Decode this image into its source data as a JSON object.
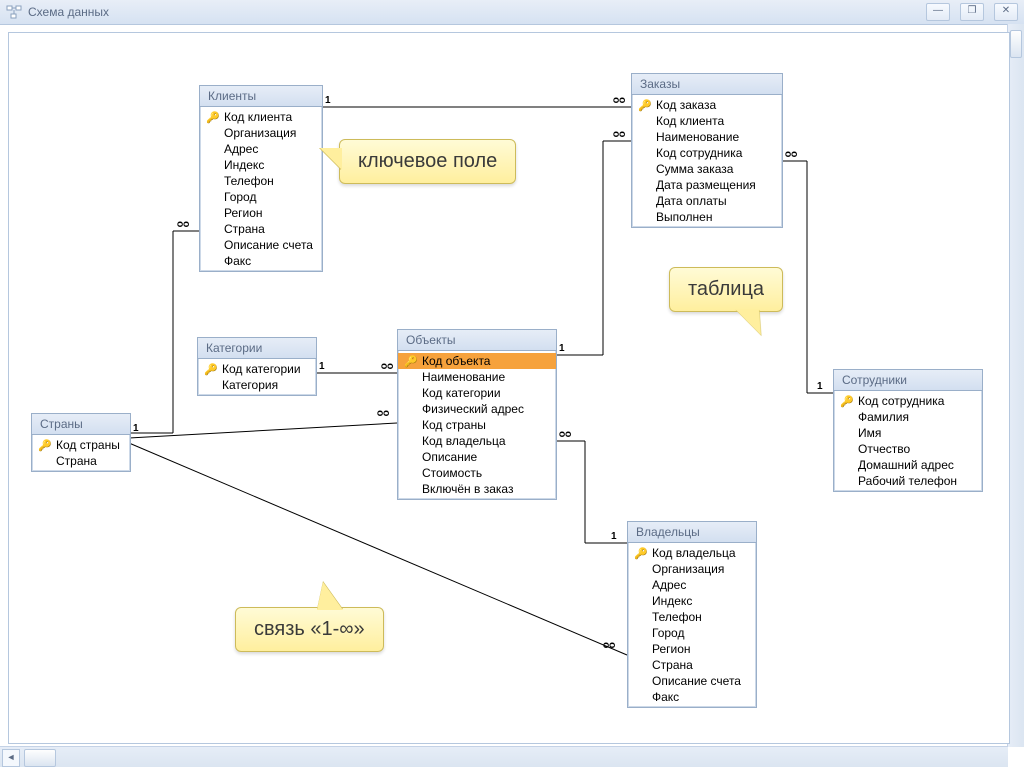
{
  "window": {
    "title": "Схема данных"
  },
  "callouts": {
    "key": "ключевое поле",
    "table": "таблица",
    "rel": "связь «1-∞»"
  },
  "symbols": {
    "one": "1",
    "many": "∞",
    "many_lig": "ᴑᴑ"
  },
  "tables": {
    "clients": {
      "title": "Клиенты",
      "fields": [
        {
          "k": true,
          "n": "Код клиента"
        },
        {
          "k": false,
          "n": "Организация"
        },
        {
          "k": false,
          "n": "Адрес"
        },
        {
          "k": false,
          "n": "Индекс"
        },
        {
          "k": false,
          "n": "Телефон"
        },
        {
          "k": false,
          "n": "Город"
        },
        {
          "k": false,
          "n": "Регион"
        },
        {
          "k": false,
          "n": "Страна"
        },
        {
          "k": false,
          "n": "Описание счета"
        },
        {
          "k": false,
          "n": "Факс"
        }
      ]
    },
    "countries": {
      "title": "Страны",
      "fields": [
        {
          "k": true,
          "n": "Код страны"
        },
        {
          "k": false,
          "n": "Страна"
        }
      ]
    },
    "categories": {
      "title": "Категории",
      "fields": [
        {
          "k": true,
          "n": "Код категории"
        },
        {
          "k": false,
          "n": "Категория"
        }
      ]
    },
    "objects": {
      "title": "Объекты",
      "fields": [
        {
          "k": true,
          "n": "Код объекта",
          "sel": true
        },
        {
          "k": false,
          "n": "Наименование"
        },
        {
          "k": false,
          "n": "Код категории"
        },
        {
          "k": false,
          "n": "Физический адрес"
        },
        {
          "k": false,
          "n": "Код страны"
        },
        {
          "k": false,
          "n": "Код владельца"
        },
        {
          "k": false,
          "n": "Описание"
        },
        {
          "k": false,
          "n": "Стоимость"
        },
        {
          "k": false,
          "n": "Включён в заказ"
        }
      ]
    },
    "orders": {
      "title": "Заказы",
      "fields": [
        {
          "k": true,
          "n": "Код заказа"
        },
        {
          "k": false,
          "n": "Код клиента"
        },
        {
          "k": false,
          "n": "Наименование"
        },
        {
          "k": false,
          "n": "Код сотрудника"
        },
        {
          "k": false,
          "n": "Сумма заказа"
        },
        {
          "k": false,
          "n": "Дата размещения"
        },
        {
          "k": false,
          "n": "Дата оплаты"
        },
        {
          "k": false,
          "n": "Выполнен"
        }
      ]
    },
    "owners": {
      "title": "Владельцы",
      "fields": [
        {
          "k": true,
          "n": "Код владельца"
        },
        {
          "k": false,
          "n": "Организация"
        },
        {
          "k": false,
          "n": "Адрес"
        },
        {
          "k": false,
          "n": "Индекс"
        },
        {
          "k": false,
          "n": "Телефон"
        },
        {
          "k": false,
          "n": "Город"
        },
        {
          "k": false,
          "n": "Регион"
        },
        {
          "k": false,
          "n": "Страна"
        },
        {
          "k": false,
          "n": "Описание счета"
        },
        {
          "k": false,
          "n": "Факс"
        }
      ]
    },
    "employees": {
      "title": "Сотрудники",
      "fields": [
        {
          "k": true,
          "n": "Код сотрудника"
        },
        {
          "k": false,
          "n": "Фамилия"
        },
        {
          "k": false,
          "n": "Имя"
        },
        {
          "k": false,
          "n": "Отчество"
        },
        {
          "k": false,
          "n": "Домашний адрес"
        },
        {
          "k": false,
          "n": "Рабочий телефон"
        }
      ]
    }
  },
  "relationships": [
    {
      "from": "clients",
      "to": "orders",
      "from_card": "1",
      "to_card": "∞"
    },
    {
      "from": "countries",
      "to": "clients",
      "from_card": "1",
      "to_card": "∞"
    },
    {
      "from": "countries",
      "to": "objects",
      "from_card": "1",
      "to_card": "∞"
    },
    {
      "from": "countries",
      "to": "owners",
      "from_card": "1",
      "to_card": "∞"
    },
    {
      "from": "categories",
      "to": "objects",
      "from_card": "1",
      "to_card": "∞"
    },
    {
      "from": "objects",
      "to": "orders",
      "from_card": "1",
      "to_card": "∞"
    },
    {
      "from": "owners",
      "to": "objects",
      "from_card": "1",
      "to_card": "∞"
    },
    {
      "from": "employees",
      "to": "orders",
      "from_card": "1",
      "to_card": "∞"
    }
  ]
}
